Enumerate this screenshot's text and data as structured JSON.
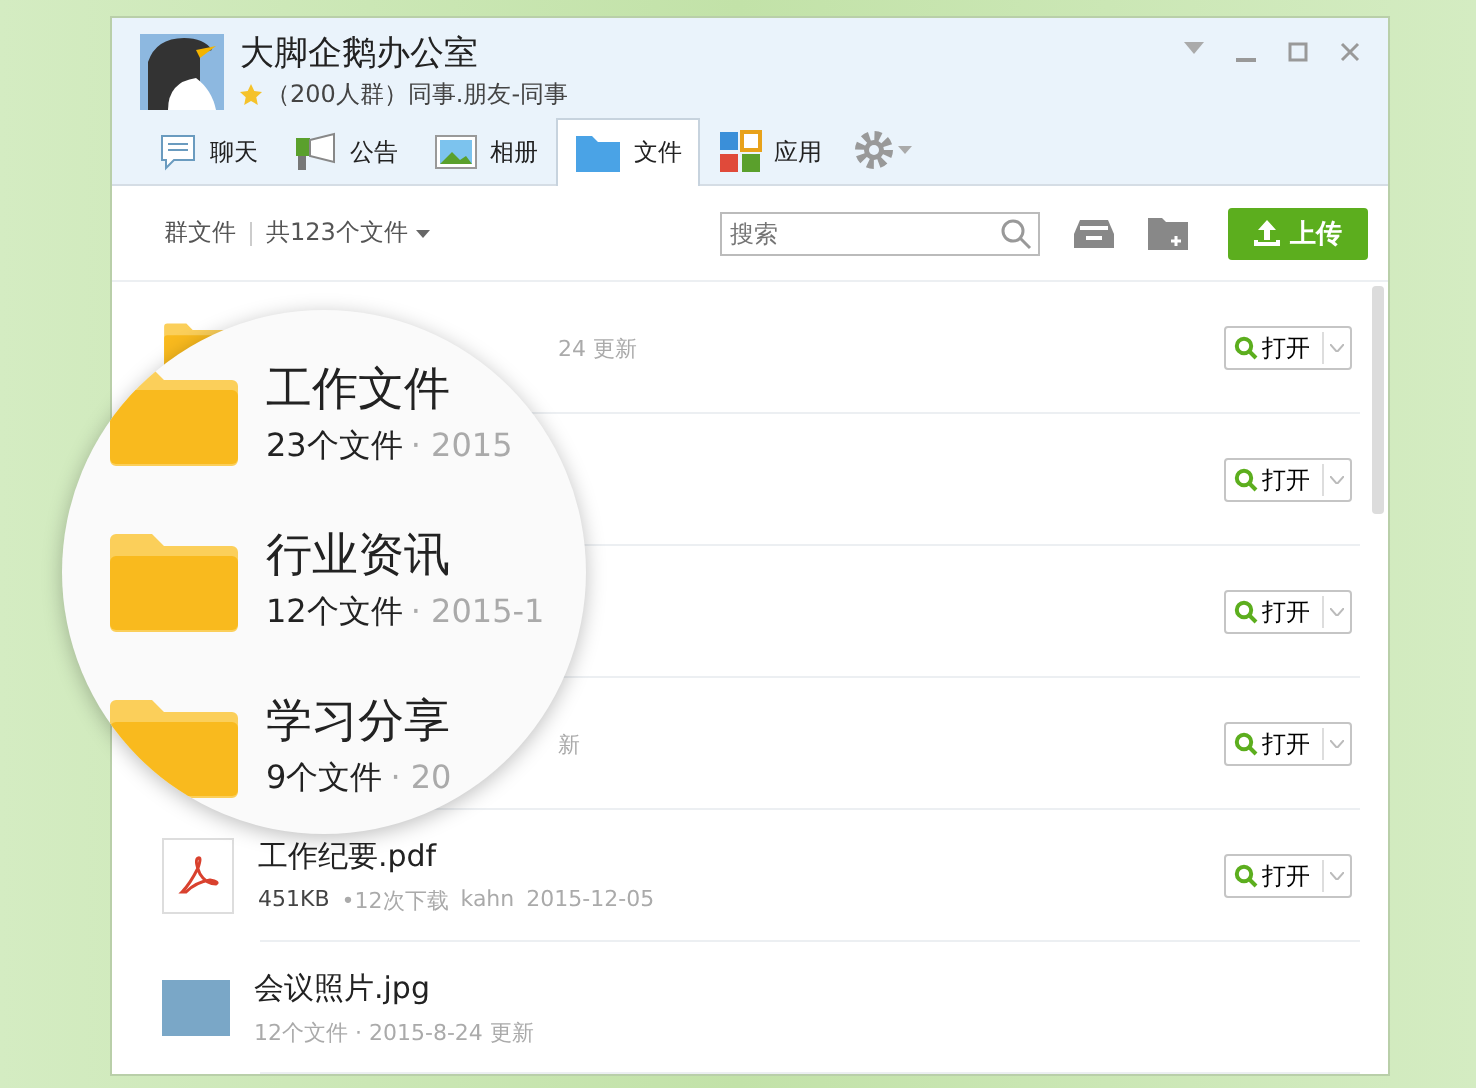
{
  "window": {
    "title": "大脚企鹅办公室",
    "subtitle": "（200人群）同事.朋友-同事"
  },
  "tabs": [
    {
      "label": "聊天",
      "kind": "chat",
      "selected": false
    },
    {
      "label": "公告",
      "kind": "notice",
      "selected": false
    },
    {
      "label": "相册",
      "kind": "album",
      "selected": false
    },
    {
      "label": "文件",
      "kind": "file",
      "selected": true
    },
    {
      "label": "应用",
      "kind": "app",
      "selected": false
    }
  ],
  "toolbar": {
    "section": "群文件",
    "count": "共123个文件",
    "search": {
      "placeholder": "搜索"
    },
    "upload": "上传"
  },
  "files": [
    {
      "kind": "folder",
      "meta": "24 更新",
      "action": "打开"
    },
    {
      "kind": "folder",
      "action": "打开"
    },
    {
      "kind": "folder",
      "action": "打开"
    },
    {
      "kind": "folder",
      "meta": "新",
      "action": "打开"
    },
    {
      "kind": "pdf",
      "name": "工作纪要.pdf",
      "size": "451KB",
      "downloads": "•12次下载",
      "uploader": "kahn",
      "date": "2015-12-05",
      "action": "打开"
    },
    {
      "kind": "image",
      "name": "会议照片.jpg",
      "meta": "12个文件 · 2015-8-24 更新"
    }
  ],
  "magnifier": {
    "folders": [
      {
        "name": "工作文件",
        "count": "23个文件",
        "date": "· 2015"
      },
      {
        "name": "行业资讯",
        "count": "12个文件",
        "date": "· 2015-1"
      },
      {
        "name": "学习分享",
        "count": "9个文件",
        "date": "· 20"
      }
    ]
  }
}
